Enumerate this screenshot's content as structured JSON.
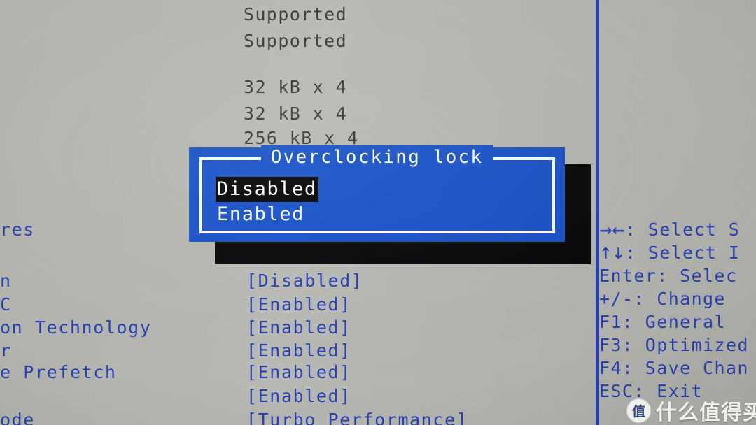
{
  "screen": {
    "background_color": "#b9b9b4",
    "text_color_blue": "#2a43b4",
    "text_color_dark": "#3a3a38",
    "dialog_color": "#1a53c8",
    "highlight_color": "#060606"
  },
  "system_info": {
    "rows": [
      {
        "value": "Supported"
      },
      {
        "value": "Supported"
      },
      {
        "value": ""
      },
      {
        "value": "32 kB x 4"
      },
      {
        "value": "32 kB x 4"
      },
      {
        "value": "256 kB x 4"
      }
    ]
  },
  "setup_items": [
    {
      "label": "res",
      "value": ""
    },
    {
      "label": "n",
      "value": "[Disabled]"
    },
    {
      "label": "C",
      "value": "[Enabled]"
    },
    {
      "label": "on Technology",
      "value": "[Enabled]"
    },
    {
      "label": "r",
      "value": "[Enabled]"
    },
    {
      "label": "e Prefetch",
      "value": "[Enabled]"
    },
    {
      "label": "",
      "value": "[Enabled]"
    },
    {
      "label": "ode",
      "value": "[Turbo Performance]"
    }
  ],
  "dialog": {
    "title": "Overclocking lock",
    "options": [
      {
        "label": "Disabled",
        "selected": true
      },
      {
        "label": "Enabled",
        "selected": false
      }
    ]
  },
  "help_panel": {
    "lines": [
      {
        "key_glyph": "→←",
        "text": ": Select S"
      },
      {
        "key_glyph": "↑↓",
        "text": ": Select I"
      },
      {
        "key_glyph": "",
        "text": "Enter: Selec"
      },
      {
        "key_glyph": "",
        "text": "+/-: Change "
      },
      {
        "key_glyph": "",
        "text": "F1: General "
      },
      {
        "key_glyph": "",
        "text": "F3: Optimized"
      },
      {
        "key_glyph": "",
        "text": "F4: Save Chan"
      },
      {
        "key_glyph": "",
        "text": "ESC: Exit"
      }
    ]
  },
  "scrollbar": {
    "thumb_top": 0,
    "thumb_height": 375
  },
  "watermark": {
    "badge": "值",
    "text": "什么值得买"
  }
}
